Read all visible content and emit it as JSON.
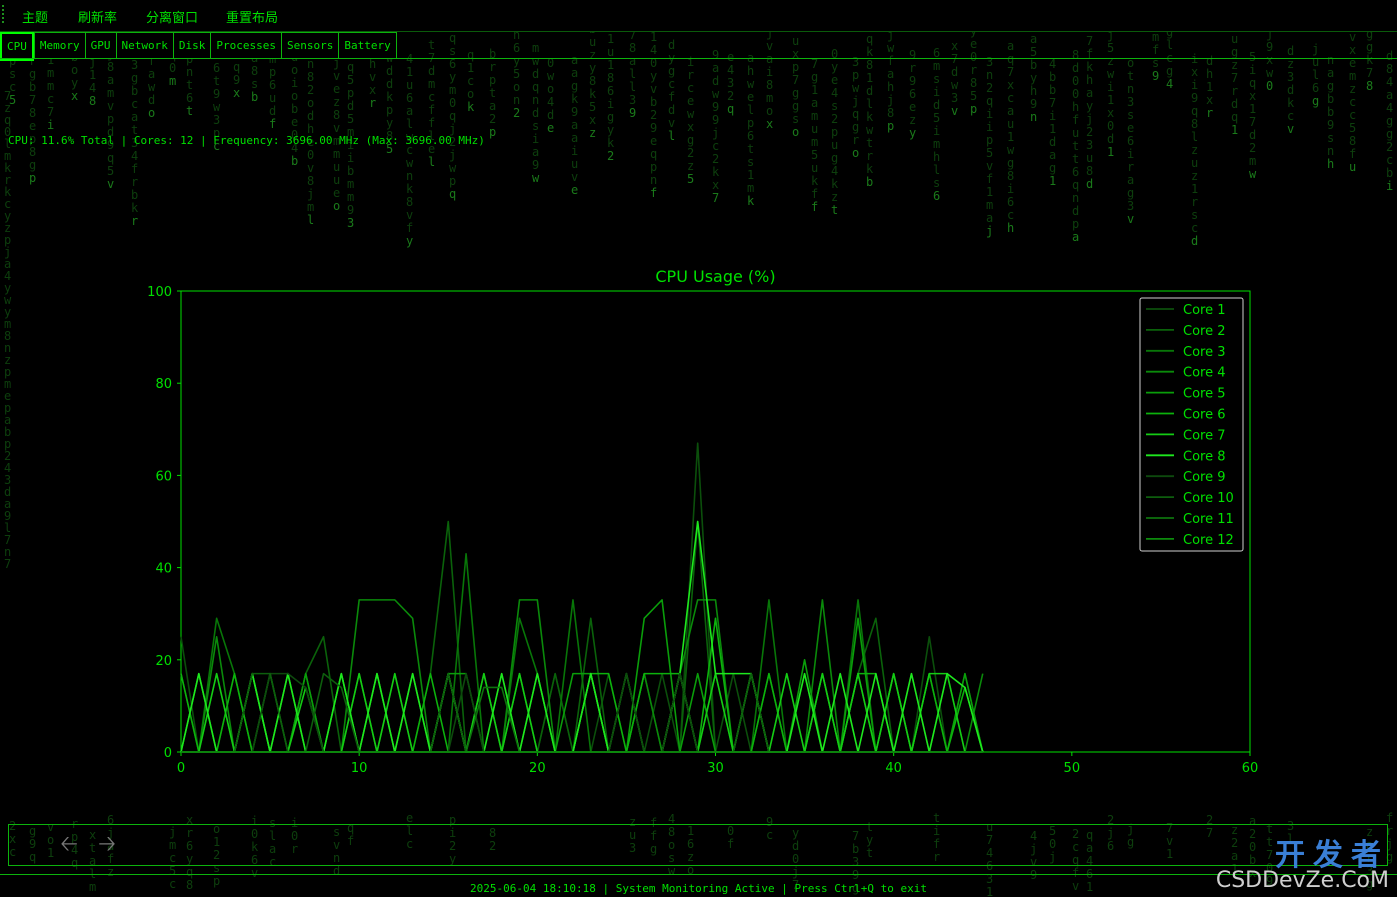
{
  "menubar": {
    "items": [
      "主题",
      "刷新率",
      "分离窗口",
      "重置布局"
    ]
  },
  "tabs": [
    {
      "label": "CPU",
      "active": true
    },
    {
      "label": "Memory",
      "active": false
    },
    {
      "label": "GPU",
      "active": false
    },
    {
      "label": "Network",
      "active": false
    },
    {
      "label": "Disk",
      "active": false
    },
    {
      "label": "Processes",
      "active": false
    },
    {
      "label": "Sensors",
      "active": false
    },
    {
      "label": "Battery",
      "active": false
    }
  ],
  "cpu_info": "CPU: 11.6% Total | Cores: 12 | Frequency: 3696.00 MHz (Max: 3696.00 MHz)",
  "nav": {
    "back_icon": "arrow-left-icon",
    "forward_icon": "arrow-right-icon"
  },
  "statusbar": "2025-06-04 18:10:18 | System Monitoring Active | Press Ctrl+Q to exit",
  "watermark": {
    "cn": "开发者",
    "en": "CSDDevZe.CoM"
  },
  "colors": {
    "accent": "#00e000",
    "border": "#0cb30c",
    "background": "#000000"
  },
  "chart_data": {
    "type": "line",
    "title": "CPU Usage (%)",
    "xlim": [
      0,
      60
    ],
    "ylim": [
      0,
      100
    ],
    "xticks": [
      0,
      10,
      20,
      30,
      40,
      50,
      60
    ],
    "yticks": [
      0,
      20,
      40,
      60,
      80,
      100
    ],
    "grid": false,
    "legend": "top-right",
    "x": [
      0,
      1,
      2,
      3,
      4,
      5,
      6,
      7,
      8,
      9,
      10,
      11,
      12,
      13,
      14,
      15,
      16,
      17,
      18,
      19,
      20,
      21,
      22,
      23,
      24,
      25,
      26,
      27,
      28,
      29,
      30,
      31,
      32,
      33,
      34,
      35,
      36,
      37,
      38,
      39,
      40,
      41,
      42,
      43,
      44,
      45
    ],
    "series": [
      {
        "name": "Core 1",
        "color": "#0b4f0b",
        "values": [
          25,
          0,
          17,
          0,
          0,
          0,
          17,
          0,
          0,
          17,
          0,
          0,
          0,
          17,
          0,
          17,
          0,
          0,
          17,
          0,
          0,
          17,
          0,
          0,
          17,
          0,
          0,
          17,
          0,
          67,
          0,
          17,
          0,
          0,
          17,
          0,
          0,
          17,
          0,
          0,
          17,
          0,
          25,
          0,
          0,
          0
        ]
      },
      {
        "name": "Core 2",
        "color": "#0a620a",
        "values": [
          0,
          17,
          0,
          17,
          0,
          0,
          0,
          17,
          25,
          0,
          0,
          17,
          0,
          0,
          17,
          50,
          0,
          0,
          17,
          0,
          0,
          17,
          0,
          29,
          0,
          0,
          17,
          0,
          0,
          50,
          0,
          0,
          17,
          0,
          0,
          17,
          0,
          0,
          17,
          29,
          0,
          17,
          0,
          0,
          17,
          0
        ]
      },
      {
        "name": "Core 3",
        "color": "#087608",
        "values": [
          17,
          0,
          29,
          17,
          0,
          17,
          0,
          0,
          0,
          17,
          0,
          0,
          17,
          0,
          0,
          0,
          43,
          0,
          0,
          29,
          17,
          0,
          33,
          0,
          0,
          17,
          0,
          0,
          17,
          0,
          17,
          0,
          0,
          33,
          0,
          0,
          17,
          0,
          33,
          0,
          17,
          0,
          0,
          17,
          0,
          0
        ]
      },
      {
        "name": "Core 4",
        "color": "#0a8a0a",
        "values": [
          0,
          0,
          25,
          0,
          0,
          17,
          0,
          17,
          0,
          0,
          33,
          33,
          33,
          29,
          0,
          17,
          0,
          0,
          0,
          33,
          33,
          0,
          0,
          17,
          0,
          0,
          17,
          0,
          17,
          33,
          33,
          0,
          0,
          17,
          0,
          0,
          33,
          0,
          17,
          0,
          0,
          0,
          17,
          0,
          0,
          17
        ]
      },
      {
        "name": "Core 5",
        "color": "#0a9e0a",
        "values": [
          0,
          17,
          0,
          0,
          17,
          0,
          0,
          17,
          0,
          0,
          17,
          0,
          0,
          17,
          0,
          17,
          17,
          0,
          0,
          17,
          0,
          0,
          17,
          17,
          0,
          0,
          29,
          33,
          0,
          17,
          0,
          0,
          17,
          0,
          0,
          20,
          0,
          0,
          29,
          0,
          17,
          0,
          0,
          0,
          17,
          0
        ]
      },
      {
        "name": "Core 6",
        "color": "#0cb20c",
        "values": [
          17,
          0,
          0,
          17,
          0,
          0,
          17,
          0,
          0,
          17,
          0,
          17,
          0,
          0,
          17,
          0,
          0,
          17,
          0,
          0,
          17,
          0,
          0,
          17,
          17,
          0,
          17,
          17,
          17,
          0,
          29,
          0,
          0,
          17,
          0,
          0,
          17,
          0,
          17,
          17,
          0,
          0,
          17,
          0,
          14,
          0
        ]
      },
      {
        "name": "Core 7",
        "color": "#14cc14",
        "values": [
          0,
          0,
          17,
          0,
          17,
          0,
          0,
          14,
          0,
          0,
          17,
          0,
          17,
          0,
          0,
          17,
          0,
          17,
          0,
          17,
          0,
          0,
          0,
          17,
          0,
          17,
          0,
          0,
          17,
          0,
          17,
          0,
          17,
          0,
          17,
          0,
          17,
          0,
          17,
          0,
          17,
          0,
          17,
          17,
          0,
          0
        ]
      },
      {
        "name": "Core 8",
        "color": "#1ee81e",
        "values": [
          0,
          17,
          0,
          0,
          17,
          0,
          17,
          0,
          0,
          17,
          0,
          17,
          0,
          17,
          0,
          17,
          0,
          0,
          17,
          0,
          17,
          0,
          0,
          17,
          0,
          0,
          0,
          0,
          17,
          50,
          17,
          17,
          17,
          0,
          0,
          17,
          0,
          17,
          0,
          17,
          0,
          17,
          0,
          17,
          14,
          0
        ]
      },
      {
        "name": "Core 9",
        "color": "#0d4a0d",
        "values": [
          0,
          0,
          0,
          0,
          0,
          17,
          17,
          14,
          0,
          0,
          0,
          0,
          0,
          0,
          0,
          0,
          17,
          0,
          0,
          0,
          0,
          0,
          0,
          0,
          0,
          17,
          0,
          0,
          17,
          0,
          0,
          0,
          0,
          0,
          0,
          0,
          0,
          0,
          0,
          0,
          0,
          0,
          0,
          0,
          0,
          0
        ]
      },
      {
        "name": "Core 10",
        "color": "#0d5e0d",
        "values": [
          0,
          0,
          0,
          0,
          17,
          17,
          0,
          0,
          17,
          14,
          0,
          0,
          0,
          0,
          0,
          17,
          0,
          0,
          0,
          0,
          0,
          0,
          0,
          0,
          0,
          0,
          0,
          0,
          0,
          0,
          0,
          0,
          17,
          0,
          0,
          0,
          0,
          0,
          0,
          0,
          0,
          0,
          0,
          0,
          0,
          0
        ]
      },
      {
        "name": "Core 11",
        "color": "#0d730d",
        "values": [
          0,
          0,
          0,
          0,
          0,
          0,
          0,
          0,
          0,
          0,
          0,
          0,
          0,
          0,
          0,
          0,
          0,
          14,
          14,
          0,
          0,
          0,
          0,
          0,
          0,
          0,
          0,
          0,
          0,
          0,
          0,
          0,
          0,
          0,
          0,
          0,
          0,
          0,
          0,
          0,
          0,
          0,
          0,
          0,
          0,
          0
        ]
      },
      {
        "name": "Core 12",
        "color": "#0c8c0c",
        "values": [
          0,
          0,
          0,
          0,
          0,
          0,
          0,
          0,
          0,
          0,
          0,
          0,
          0,
          0,
          0,
          0,
          0,
          0,
          0,
          0,
          0,
          0,
          0,
          0,
          0,
          0,
          0,
          0,
          0,
          0,
          0,
          0,
          0,
          0,
          0,
          0,
          0,
          0,
          0,
          0,
          0,
          0,
          0,
          0,
          0,
          0
        ]
      }
    ]
  }
}
